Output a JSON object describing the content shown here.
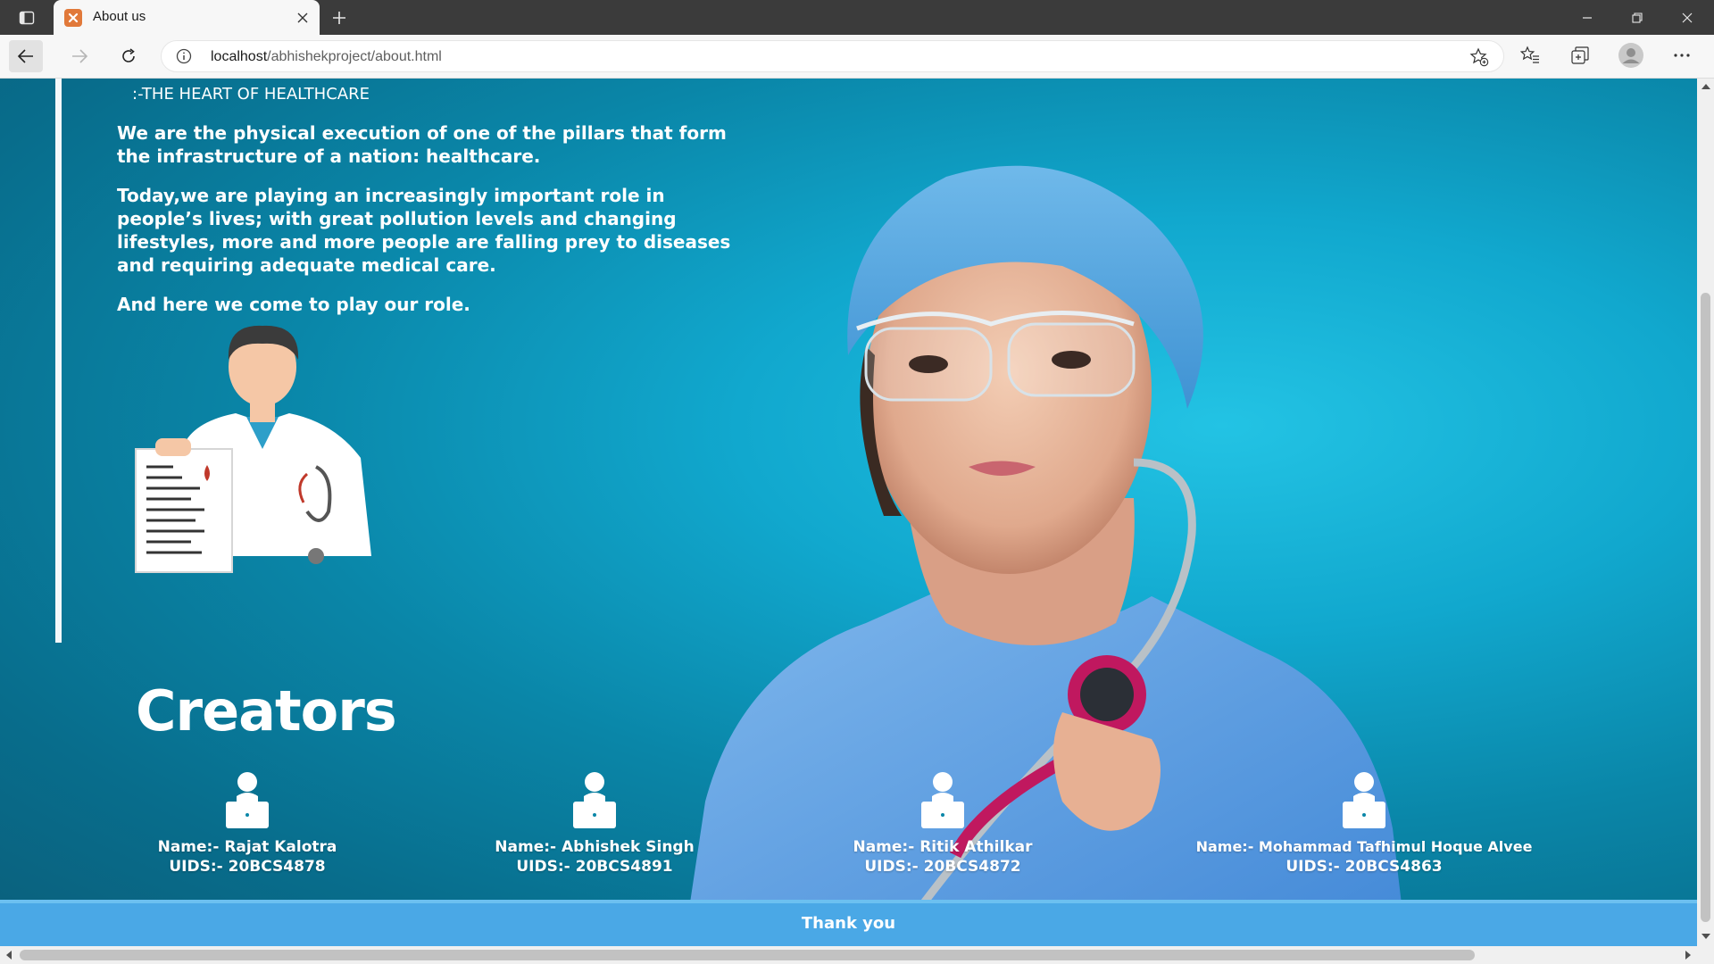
{
  "browser": {
    "tab_title": "About us",
    "url_host": "localhost",
    "url_path": "/abhishekproject/about.html"
  },
  "about": {
    "heading": ":-THE HEART OF HEALTHCARE",
    "paragraphs": [
      "We are the physical execution of one of the pillars that form the infrastructure of a nation: healthcare.",
      "Today,we are playing an increasingly important role in people’s lives; with great pollution levels and changing lifestyles, more and more people are falling prey to diseases and requiring adequate medical care.",
      "And here we come to play our role."
    ]
  },
  "creators": {
    "title": "Creators",
    "members": [
      {
        "name": "Name:- Rajat Kalotra",
        "uid": "UIDS:- 20BCS4878"
      },
      {
        "name": "Name:- Abhishek Singh",
        "uid": "UIDS:- 20BCS4891"
      },
      {
        "name": "Name:- Ritik Athilkar",
        "uid": "UIDS:- 20BCS4872"
      },
      {
        "name": "Name:- Mohammad Tafhimul Hoque Alvee",
        "uid": "UIDS:- 20BCS4863"
      }
    ]
  },
  "footer": {
    "text": "Thank you"
  },
  "colors": {
    "footer_bg": "#4aa8e6",
    "page_bg": "#0a86a8",
    "favicon": "#e1793a"
  },
  "icons": [
    "tab-actions-icon",
    "xampp-favicon",
    "close-icon",
    "plus-icon",
    "minimize-icon",
    "restore-icon",
    "window-close-icon",
    "back-arrow-icon",
    "forward-arrow-icon",
    "reload-icon",
    "info-icon",
    "add-favorite-icon",
    "favorites-icon",
    "collections-icon",
    "profile-icon",
    "more-icon",
    "person-laptop-icon"
  ]
}
